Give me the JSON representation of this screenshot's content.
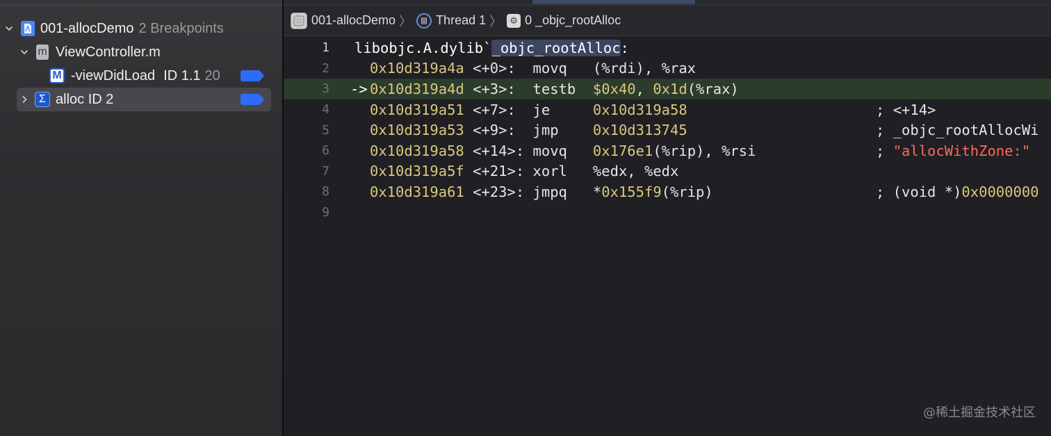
{
  "navigator": {
    "project": {
      "name": "001-allocDemo",
      "detail": "2 Breakpoints"
    },
    "file": {
      "name": "ViewController.m",
      "badge": "m"
    },
    "method_bp": {
      "badge": "M",
      "name": "-viewDidLoad",
      "id": "ID 1.1",
      "line": "20"
    },
    "symbol_bp": {
      "badge": "Σ",
      "name": "alloc ID 2"
    }
  },
  "jumpbar": {
    "project": "001-allocDemo",
    "thread": "Thread 1",
    "frame": "0 _objc_rootAlloc"
  },
  "code": {
    "header_prefix": "libobjc.A.dylib`",
    "header_symbol": "_objc_rootAlloc",
    "header_suffix": ":",
    "current_arrow": "->",
    "lines": [
      {
        "n": "1"
      },
      {
        "n": "2",
        "addr": "0x10d319a4a",
        "off": " <+0>:  ",
        "op": "movq   ",
        "args": "(%rdi), %rax"
      },
      {
        "n": "3",
        "addr": "0x10d319a4d",
        "off": " <+3>:  ",
        "op": "testb  ",
        "args_num1": "$0x40",
        "args_mid": ", ",
        "args_num2": "0x1d",
        "args_end": "(%rax)"
      },
      {
        "n": "4",
        "addr": "0x10d319a51",
        "off": " <+7>:  ",
        "op": "je     ",
        "target": "0x10d319a58",
        "comment_prefix": "; ",
        "comment": "<+14>"
      },
      {
        "n": "5",
        "addr": "0x10d319a53",
        "off": " <+9>:  ",
        "op": "jmp    ",
        "target": "0x10d313745",
        "comment_prefix": "; ",
        "comment": "_objc_rootAllocWi"
      },
      {
        "n": "6",
        "addr": "0x10d319a58",
        "off": " <+14>: ",
        "op": "movq   ",
        "args_num1": "0x176e1",
        "args_end": "(%rip), %rsi",
        "comment_prefix": "; ",
        "comment_str": "\"allocWithZone:\""
      },
      {
        "n": "7",
        "addr": "0x10d319a5f",
        "off": " <+21>: ",
        "op": "xorl   ",
        "args": "%edx, %edx"
      },
      {
        "n": "8",
        "addr": "0x10d319a61",
        "off": " <+23>: ",
        "op": "jmpq   ",
        "args_pre": "*",
        "args_num1": "0x155f9",
        "args_end": "(%rip)",
        "comment_prefix": "; (void *)",
        "comment_num": "0x0000000"
      },
      {
        "n": "9"
      }
    ]
  },
  "watermark": "@稀土掘金技术社区"
}
